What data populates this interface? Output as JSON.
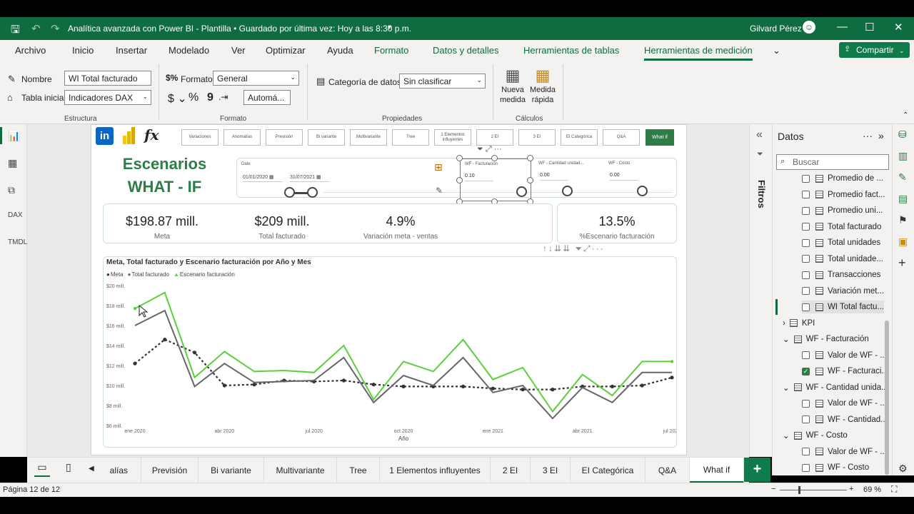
{
  "window": {
    "title": "Analítica avanzada con Power BI - Plantilla • Guardado por última vez: Hoy a las 8:30 p.m.",
    "user": "Gilvard Pérez"
  },
  "menu": [
    "Archivo",
    "Inicio",
    "Insertar",
    "Modelado",
    "Ver",
    "Optimizar",
    "Ayuda",
    "Formato",
    "Datos y detalles",
    "Herramientas de tablas",
    "Herramientas de medición"
  ],
  "share_label": "Compartir",
  "ribbon": {
    "nombre_label": "Nombre",
    "nombre_value": "WI Total facturado",
    "tabla_label": "Tabla inicial",
    "tabla_value": "Indicadores DAX",
    "estructura": "Estructura",
    "formato_label": "Formato",
    "formato_value": "General",
    "auto_value": "Automá...",
    "formato_group": "Formato",
    "categoria_label": "Categoría de datos",
    "categoria_value": "Sin clasificar",
    "propiedades": "Propiedades",
    "nueva_medida": "Nueva medida",
    "medida_rapida": "Medida rápida",
    "calculos": "Cálculos"
  },
  "report": {
    "nav": [
      "Variaciones",
      "Anomalías",
      "Previsión",
      "Bi variante",
      "Multivariante",
      "Tree",
      "1 Elementos influyentes",
      "2 EI",
      "3 EI",
      "EI Categórica",
      "Q&A",
      "What if"
    ],
    "title_line1": "Escenarios",
    "title_line2": "WHAT - IF",
    "date_slicer": {
      "label": "Date",
      "from": "01/01/2020",
      "to": "31/07/2021"
    },
    "wf_fact": {
      "label": "WF - Facturación",
      "value": "0.10"
    },
    "wf_cant": {
      "label": "WF - Cantidad unidad...",
      "value": "0.00"
    },
    "wf_costo": {
      "label": "WF - Costo",
      "value": "0.00"
    },
    "kpis": [
      {
        "value": "$198.87 mill.",
        "label": "Meta"
      },
      {
        "value": "$209 mill.",
        "label": "Total facturado"
      },
      {
        "value": "4.9%",
        "label": "Variación meta - ventas"
      },
      {
        "value": "13.5%",
        "label": "%Escenario facturación"
      }
    ]
  },
  "chart_data": {
    "type": "line",
    "title": "Meta, Total facturado y Escenario facturación por Año y Mes",
    "xlabel": "Año",
    "ylabel": "",
    "ylim": [
      6,
      20
    ],
    "y_ticks": [
      "$20 mill.",
      "$18 mill.",
      "$16 mill.",
      "$14 mill.",
      "$12 mill.",
      "$10 mill.",
      "$8 mill.",
      "$6 mill."
    ],
    "x_ticks": [
      "ene 2020",
      "abr 2020",
      "jul 2020",
      "oct 2020",
      "ene 2021",
      "abr 2021",
      "jul 2021"
    ],
    "categories": [
      "ene 2020",
      "feb 2020",
      "mar 2020",
      "abr 2020",
      "may 2020",
      "jun 2020",
      "jul 2020",
      "ago 2020",
      "sep 2020",
      "oct 2020",
      "nov 2020",
      "dic 2020",
      "ene 2021",
      "feb 2021",
      "mar 2021",
      "abr 2021",
      "may 2021",
      "jun 2021",
      "jul 2021"
    ],
    "series": [
      {
        "name": "Meta",
        "color": "#333333",
        "values": [
          12.2,
          14.6,
          13.3,
          10.0,
          10.1,
          10.5,
          10.4,
          10.5,
          10.1,
          9.9,
          9.9,
          9.9,
          9.7,
          9.6,
          9.6,
          9.9,
          9.9,
          10.0,
          10.8
        ]
      },
      {
        "name": "Total facturado",
        "color": "#666666",
        "values": [
          16.0,
          17.5,
          9.9,
          12.2,
          10.3,
          10.4,
          10.5,
          12.8,
          8.3,
          11.0,
          10.0,
          12.8,
          9.3,
          10.0,
          6.7,
          9.8,
          8.3,
          11.3,
          11.3
        ]
      },
      {
        "name": "Escenario facturación",
        "color": "#5bd03c",
        "values": [
          17.7,
          19.3,
          10.8,
          13.4,
          11.4,
          11.5,
          11.3,
          14.0,
          8.6,
          12.4,
          11.4,
          14.6,
          10.6,
          11.8,
          7.4,
          11.1,
          9.0,
          12.4,
          12.4
        ]
      }
    ]
  },
  "filters_label": "Filtros",
  "data_pane": {
    "title": "Datos",
    "search_placeholder": "Buscar",
    "items": [
      {
        "label": "Promedio de ...",
        "type": "measure",
        "checked": false
      },
      {
        "label": "Promedio fact...",
        "type": "measure",
        "checked": false
      },
      {
        "label": "Promedio uni...",
        "type": "measure",
        "checked": false
      },
      {
        "label": "Total facturado",
        "type": "measure",
        "checked": false
      },
      {
        "label": "Total unidades",
        "type": "measure",
        "checked": false
      },
      {
        "label": "Total unidade...",
        "type": "measure",
        "checked": false
      },
      {
        "label": "Transacciones",
        "type": "measure",
        "checked": false
      },
      {
        "label": "Variación met...",
        "type": "measure",
        "checked": false
      },
      {
        "label": "WI Total factu...",
        "type": "measure",
        "checked": false
      },
      {
        "label": "KPI",
        "type": "table"
      },
      {
        "label": "WF - Facturación",
        "type": "table-open"
      },
      {
        "label": "Valor de WF - ...",
        "type": "measure",
        "checked": false
      },
      {
        "label": "WF - Facturaci...",
        "type": "param",
        "checked": true
      },
      {
        "label": "WF - Cantidad unida...",
        "type": "table-open"
      },
      {
        "label": "Valor de WF - ...",
        "type": "measure",
        "checked": false
      },
      {
        "label": "WF - Cantidad...",
        "type": "param",
        "checked": false
      },
      {
        "label": "WF - Costo",
        "type": "table-open"
      },
      {
        "label": "Valor de WF - ...",
        "type": "measure",
        "checked": false
      },
      {
        "label": "WF - Costo",
        "type": "param",
        "checked": false
      }
    ]
  },
  "page_tabs": [
    "alías",
    "Previsión",
    "Bi variante",
    "Multivariante",
    "Tree",
    "1 Elementos influyentes",
    "2 EI",
    "3 EI",
    "EI Categórica",
    "Q&A",
    "What if"
  ],
  "status": {
    "page": "Página 12 de 12",
    "zoom": "69 %"
  }
}
